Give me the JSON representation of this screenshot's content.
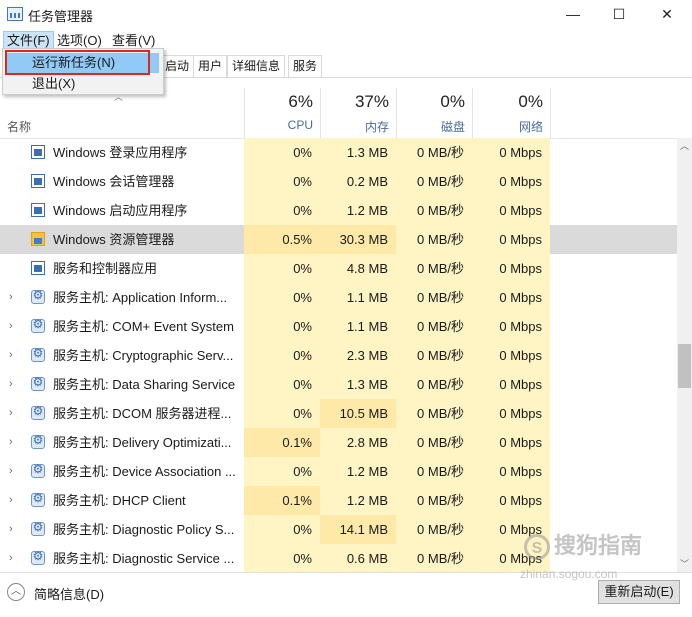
{
  "window": {
    "title": "任务管理器",
    "minimize_glyph": "—",
    "maximize_glyph": "☐",
    "close_glyph": "✕"
  },
  "menubar": {
    "items": [
      "文件(F)",
      "选项(O)",
      "查看(V)"
    ]
  },
  "file_menu": {
    "items": [
      "运行新任务(N)",
      "退出(X)"
    ],
    "highlighted": "运行新任务(N)"
  },
  "tabs": [
    "启动",
    "用户",
    "详细信息",
    "服务"
  ],
  "columns": {
    "name_label": "名称",
    "cpu": {
      "percent": "6%",
      "label": "CPU"
    },
    "memory": {
      "percent": "37%",
      "label": "内存"
    },
    "disk": {
      "percent": "0%",
      "label": "磁盘"
    },
    "network": {
      "percent": "0%",
      "label": "网络"
    }
  },
  "rows": [
    {
      "name": "Windows 登录应用程序",
      "icon": "window-app-icon",
      "expandable": false,
      "cpu": "0%",
      "mem": "1.3 MB",
      "disk": "0 MB/秒",
      "net": "0 Mbps"
    },
    {
      "name": "Windows 会话管理器",
      "icon": "window-app-icon",
      "expandable": false,
      "cpu": "0%",
      "mem": "0.2 MB",
      "disk": "0 MB/秒",
      "net": "0 Mbps"
    },
    {
      "name": "Windows 启动应用程序",
      "icon": "window-app-icon",
      "expandable": false,
      "cpu": "0%",
      "mem": "1.2 MB",
      "disk": "0 MB/秒",
      "net": "0 Mbps"
    },
    {
      "name": "Windows 资源管理器",
      "icon": "folder-icon",
      "expandable": false,
      "selected": true,
      "cpu": "0.5%",
      "mem": "30.3 MB",
      "disk": "0 MB/秒",
      "net": "0 Mbps"
    },
    {
      "name": "服务和控制器应用",
      "icon": "window-app-icon",
      "expandable": false,
      "cpu": "0%",
      "mem": "4.8 MB",
      "disk": "0 MB/秒",
      "net": "0 Mbps"
    },
    {
      "name": "服务主机: Application Inform...",
      "icon": "gear-icon",
      "expandable": true,
      "cpu": "0%",
      "mem": "1.1 MB",
      "disk": "0 MB/秒",
      "net": "0 Mbps"
    },
    {
      "name": "服务主机: COM+ Event System",
      "icon": "gear-icon",
      "expandable": true,
      "cpu": "0%",
      "mem": "1.1 MB",
      "disk": "0 MB/秒",
      "net": "0 Mbps"
    },
    {
      "name": "服务主机: Cryptographic Serv...",
      "icon": "gear-icon",
      "expandable": true,
      "cpu": "0%",
      "mem": "2.3 MB",
      "disk": "0 MB/秒",
      "net": "0 Mbps"
    },
    {
      "name": "服务主机: Data Sharing Service",
      "icon": "gear-icon",
      "expandable": true,
      "cpu": "0%",
      "mem": "1.3 MB",
      "disk": "0 MB/秒",
      "net": "0 Mbps"
    },
    {
      "name": "服务主机: DCOM 服务器进程...",
      "icon": "gear-icon",
      "expandable": true,
      "cpu": "0%",
      "mem": "10.5 MB",
      "disk": "0 MB/秒",
      "net": "0 Mbps"
    },
    {
      "name": "服务主机: Delivery Optimizati...",
      "icon": "gear-icon",
      "expandable": true,
      "cpu": "0.1%",
      "mem": "2.8 MB",
      "disk": "0 MB/秒",
      "net": "0 Mbps"
    },
    {
      "name": "服务主机: Device Association ...",
      "icon": "gear-icon",
      "expandable": true,
      "cpu": "0%",
      "mem": "1.2 MB",
      "disk": "0 MB/秒",
      "net": "0 Mbps"
    },
    {
      "name": "服务主机: DHCP Client",
      "icon": "gear-icon",
      "expandable": true,
      "cpu": "0.1%",
      "mem": "1.2 MB",
      "disk": "0 MB/秒",
      "net": "0 Mbps"
    },
    {
      "name": "服务主机: Diagnostic Policy S...",
      "icon": "gear-icon",
      "expandable": true,
      "cpu": "0%",
      "mem": "14.1 MB",
      "disk": "0 MB/秒",
      "net": "0 Mbps"
    },
    {
      "name": "服务主机: Diagnostic Service ...",
      "icon": "gear-icon",
      "expandable": true,
      "cpu": "0%",
      "mem": "0.6 MB",
      "disk": "0 MB/秒",
      "net": "0 Mbps"
    }
  ],
  "footer": {
    "less_details": "简略信息(D)",
    "restart_button": "重新启动(E)"
  },
  "watermark": {
    "text": "搜狗指南",
    "url": "zhinan.sogou.com"
  },
  "colors": {
    "cell_bg": "#fff4c4",
    "cell_hot": "#ffe9a8",
    "selected_row": "#dadada",
    "menu_highlight": "#91c9f7",
    "annotation_box": "#e0271c"
  }
}
